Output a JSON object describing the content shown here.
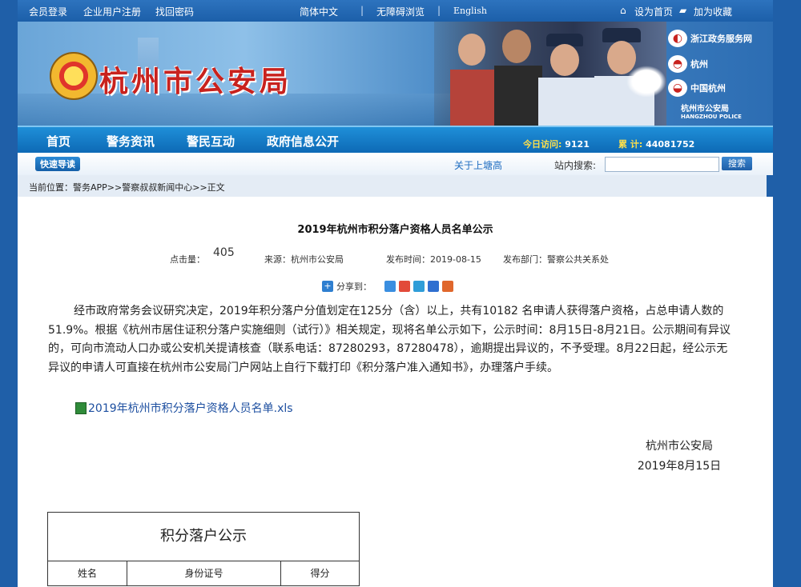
{
  "topbar": {
    "login": "会员登录",
    "register": "企业用户注册",
    "recover": "找回密码",
    "simplified": "简体中文",
    "accessible": "无障碍浏览",
    "english": "English",
    "set_home": "设为首页",
    "favorite": "加为收藏"
  },
  "banner": {
    "site_title": "杭州市公安局",
    "right_logos": [
      "浙江政务服务网",
      "中国杭州",
      "杭州市公安局"
    ],
    "right_logo_sub": "HANGZHOU POLICE"
  },
  "nav": {
    "items": [
      "首页",
      "警务资讯",
      "警民互动",
      "政府信息公开"
    ],
    "today_label": "今日访问:",
    "today_value": "9121",
    "total_label": "累 计:",
    "total_value": "44081752"
  },
  "searchrow": {
    "quick_nav": "快速导读",
    "about": "关于上塘高",
    "search_label": "站内搜索:",
    "search_button": "搜索"
  },
  "breadcrumb": "当前位置：警务APP>>警察叔叔新闻中心>>正文",
  "article": {
    "title": "2019年杭州市积分落户资格人员名单公示",
    "hits_label": "点击量：",
    "hits_value": "405",
    "source": "来源：杭州市公安局",
    "published": "发布时间：2019-08-15",
    "department": "发布部门：警察公共关系处",
    "share_label": "分享到：",
    "body": "经市政府常务会议研究决定，2019年积分落户分值划定在125分（含）以上，共有10182 名申请人获得落户资格，占总申请人数的51.9%。根据《杭州市居住证积分落户实施细则（试行）》相关规定，现将名单公示如下，公示时间：8月15日-8月21日。公示期间有异议的，可向市流动人口办或公安机关提请核查（联系电话：87280293，87280478），逾期提出异议的，不予受理。8月22日起，经公示无异议的申请人可直接在杭州市公安局门户网站上自行下载打印《积分落户准入通知书》，办理落户手续。",
    "attachment": "2019年杭州市积分落户资格人员名单.xls",
    "sign_org": "杭州市公安局",
    "sign_date": "2019年8月15日"
  },
  "table": {
    "title": "积分落户公示",
    "columns": [
      "姓名",
      "身份证号",
      "得分"
    ]
  }
}
